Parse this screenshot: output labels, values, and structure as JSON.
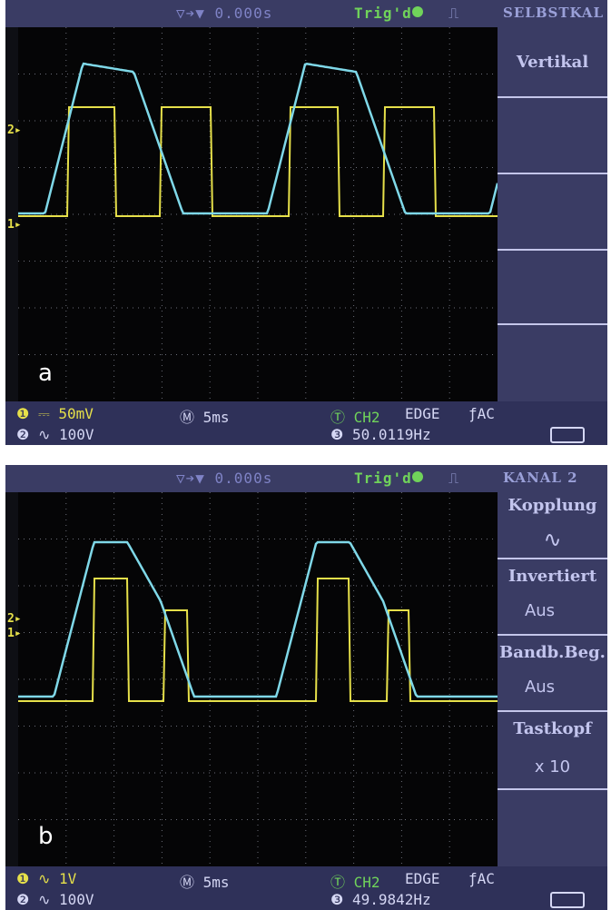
{
  "panel_a": {
    "label": "a",
    "topbar": {
      "delay": "▽➔▼ 0.000s",
      "trigger": "Trig'd",
      "menu_title": "SELBSTKAL"
    },
    "side_menu": {
      "title": "Vertikal"
    },
    "status": {
      "ch1": "❶ ⎓ 50mV",
      "ch2": "❷ ∿ 100V",
      "timebase": "Ⓜ 5ms",
      "trigger_source": "Ⓣ CH2",
      "trigger_type": "EDGE",
      "coupling": "ƒAC",
      "frequency": "❸ 50.0119Hz"
    },
    "markers": {
      "ch2": "2▸",
      "ch1": "1▸"
    }
  },
  "panel_b": {
    "label": "b",
    "topbar": {
      "delay": "▽➔▼ 0.000s",
      "trigger": "Trig'd",
      "menu_title": "KANAL 2"
    },
    "side_menu": {
      "items": [
        {
          "label": "Kopplung",
          "value": "∿"
        },
        {
          "label": "Invertiert",
          "value": "Aus"
        },
        {
          "label": "Bandb.Beg.",
          "value": "Aus"
        },
        {
          "label": "Tastkopf",
          "value": "x 10"
        }
      ]
    },
    "status": {
      "ch1": "❶ ∿ 1V",
      "ch2": "❷ ∿ 100V",
      "timebase": "Ⓜ 5ms",
      "trigger_source": "Ⓣ CH2",
      "trigger_type": "EDGE",
      "coupling": "ƒAC",
      "frequency": "❸ 49.9842Hz"
    },
    "markers": {
      "ch2": "2▸",
      "ch1": "1▸"
    }
  },
  "colors": {
    "ch1": "#e6e04a",
    "ch2": "#7fd8e8",
    "grid": "#6b6d78",
    "menu_bg": "#3a3c64"
  }
}
